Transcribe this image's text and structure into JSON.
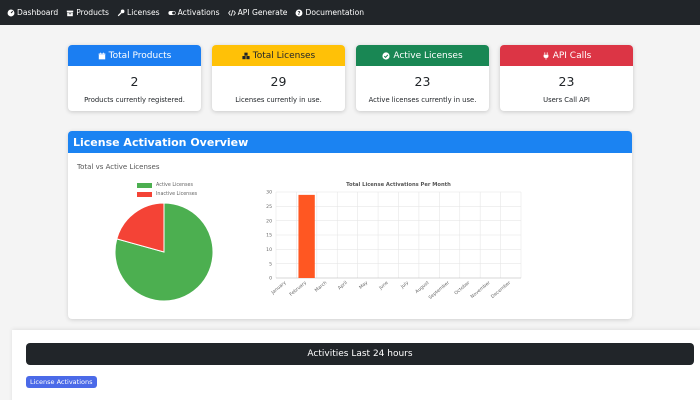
{
  "nav": {
    "items": [
      {
        "label": "Dashboard",
        "icon": "gauge-icon"
      },
      {
        "label": "Products",
        "icon": "box-icon"
      },
      {
        "label": "Licenses",
        "icon": "key-icon"
      },
      {
        "label": "Activations",
        "icon": "toggle-icon"
      },
      {
        "label": "API Generate",
        "icon": "code-icon"
      },
      {
        "label": "Documentation",
        "icon": "question-icon"
      }
    ]
  },
  "cards": [
    {
      "title": "Total Products",
      "value": "2",
      "desc": "Products currently registered.",
      "color": "#1b7ef2",
      "text_color": "#ffffff",
      "icon": "calendar-icon"
    },
    {
      "title": "Total Licenses",
      "value": "29",
      "desc": "Licenses currently in use.",
      "color": "#ffc107",
      "text_color": "#212529",
      "icon": "boxes-icon"
    },
    {
      "title": "Active Licenses",
      "value": "23",
      "desc": "Active licenses currently in use.",
      "color": "#198754",
      "text_color": "#ffffff",
      "icon": "check-circle-icon"
    },
    {
      "title": "API Calls",
      "value": "23",
      "desc": "Users Call API",
      "color": "#dc3545",
      "text_color": "#ffffff",
      "icon": "plug-icon"
    }
  ],
  "overview": {
    "title": "License Activation Overview",
    "subtitle": "Total vs Active Licenses"
  },
  "chart_data": [
    {
      "type": "pie",
      "categories": [
        "Active Licenses",
        "Inactive Licenses"
      ],
      "values": [
        23,
        6
      ],
      "colors": [
        "#4caf50",
        "#f44336"
      ],
      "legend": "top"
    },
    {
      "type": "bar",
      "title": "Total License Activations Per Month",
      "categories": [
        "January",
        "February",
        "March",
        "April",
        "May",
        "June",
        "July",
        "August",
        "September",
        "October",
        "November",
        "December"
      ],
      "values": [
        0,
        29,
        0,
        0,
        0,
        0,
        0,
        0,
        0,
        0,
        0,
        0
      ],
      "ylim": [
        0,
        30
      ],
      "yticks": [
        0,
        5,
        10,
        15,
        20,
        25,
        30
      ],
      "color": "#ff5722",
      "grid": true
    }
  ],
  "activities": {
    "title": "Activities Last 24 hours",
    "badge": "License Activations"
  }
}
